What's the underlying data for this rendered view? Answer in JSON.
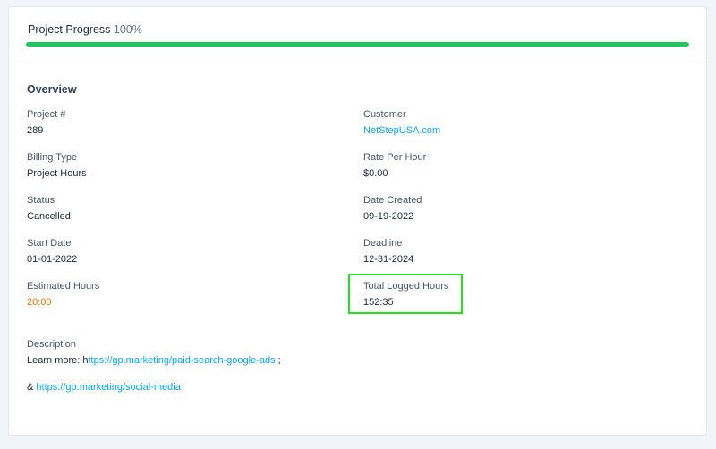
{
  "progress": {
    "label": "Project Progress",
    "percent_text": "100%",
    "value_percent": 100,
    "bar_color": "#22c55e"
  },
  "overview": {
    "title": "Overview",
    "project_number": {
      "label": "Project #",
      "value": "289"
    },
    "customer": {
      "label": "Customer",
      "value": "NetStepUSA.com"
    },
    "billing_type": {
      "label": "Billing Type",
      "value": "Project Hours"
    },
    "rate_per_hour": {
      "label": "Rate Per Hour",
      "value": "$0.00"
    },
    "status": {
      "label": "Status",
      "value": "Cancelled"
    },
    "date_created": {
      "label": "Date Created",
      "value": "09-19-2022"
    },
    "start_date": {
      "label": "Start Date",
      "value": "01-01-2022"
    },
    "deadline": {
      "label": "Deadline",
      "value": "12-31-2024"
    },
    "estimated_hours": {
      "label": "Estimated Hours",
      "value": "20:00"
    },
    "total_logged_hours": {
      "label": "Total Logged Hours",
      "value": "152:35"
    }
  },
  "description": {
    "label": "Description",
    "line1_prefix": "Learn more: h",
    "line1_link": "ttps://gp.marketing/paid-search-google-ads",
    "line1_suffix": " ;",
    "line2_prefix": "& ",
    "line2_link": "https://gp.marketing/social-media"
  },
  "colors": {
    "link": "#0ea5e9",
    "estimated_hours": "#d97706",
    "highlight": "#22e022"
  }
}
